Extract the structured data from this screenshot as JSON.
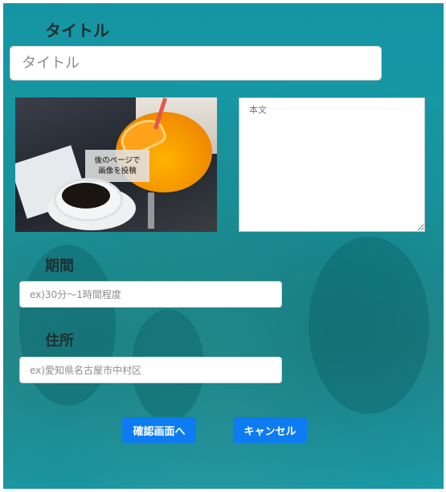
{
  "form": {
    "title_label": "タイトル",
    "title_placeholder": "タイトル",
    "image_hint_line1": "後のページで",
    "image_hint_line2": "画像を投稿",
    "body_placeholder": "本文",
    "period_label": "期間",
    "period_placeholder": "ex)30分〜1時間程度",
    "address_label": "住所",
    "address_placeholder": "ex)愛知県名古屋市中村区",
    "confirm_label": "確認画面へ",
    "cancel_label": "キャンセル"
  },
  "colors": {
    "background": "#1a9aa5",
    "button": "#0d7cf2",
    "label_text": "#1f2f33"
  }
}
